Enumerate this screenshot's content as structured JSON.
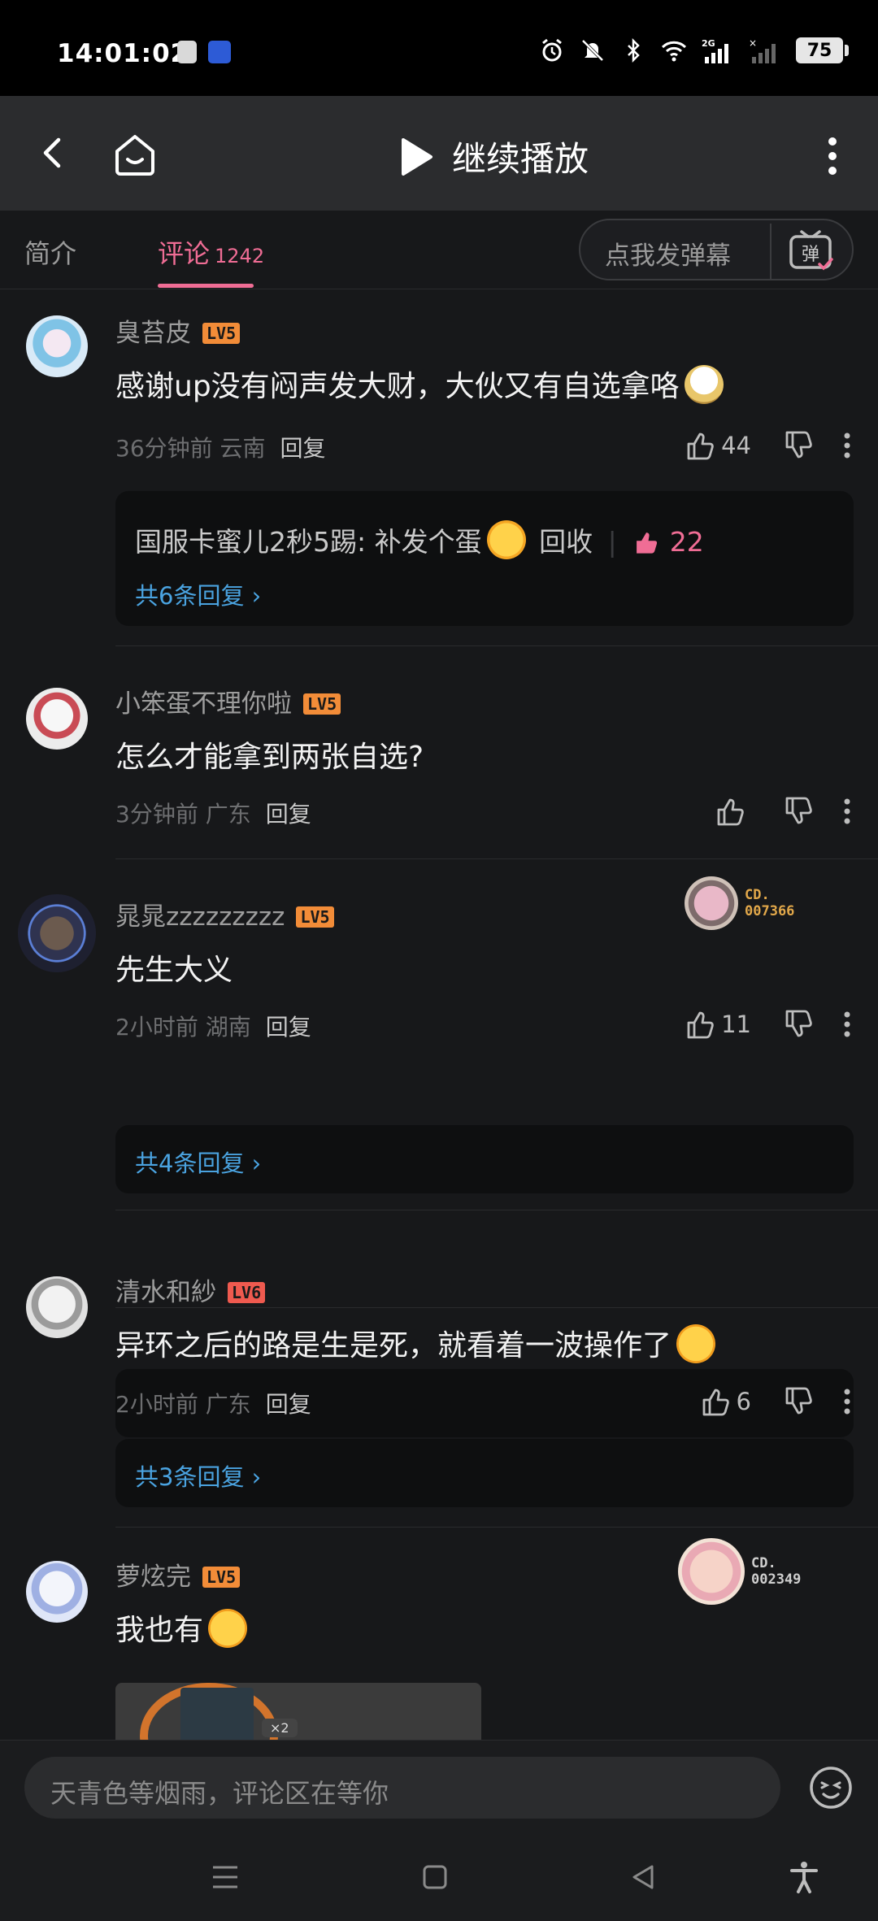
{
  "status_bar": {
    "time": "14:01:02",
    "battery": "75",
    "network": "2G"
  },
  "header": {
    "title": "继续播放"
  },
  "tabs": [
    {
      "label": "简介"
    },
    {
      "label": "评论",
      "count": "1242"
    }
  ],
  "danmaku": {
    "placeholder": "点我发弹幕",
    "icon_label": "弹"
  },
  "comments": [
    {
      "user": "臭苔皮",
      "level": "LV5",
      "text": "感谢up没有闷声发大财，大伙又有自选拿咯",
      "time": "36分钟前 云南",
      "reply": "回复",
      "likes": "44",
      "sub_reply": {
        "user": "国服卡蜜儿2秒5踢",
        "text": "补发个蛋",
        "action": "回收",
        "likes": "22"
      },
      "more_replies": "共6条回复"
    },
    {
      "user": "小笨蛋不理你啦",
      "level": "LV5",
      "text": "怎么才能拿到两张自选?",
      "time": "3分钟前 广东",
      "reply": "回复",
      "likes": ""
    },
    {
      "user": "晁晁zzzzzzzzz",
      "level": "LV5",
      "text": "先生大义",
      "time": "2小时前 湖南",
      "reply": "回复",
      "likes": "11",
      "badge": {
        "line1": "CD.",
        "line2": "007366"
      },
      "more_replies": "共4条回复"
    },
    {
      "user": "清水和紗",
      "level": "LV6",
      "text": "异环之后的路是生是死，就看着一波操作了",
      "time": "2小时前 广东",
      "reply": "回复",
      "likes": "6",
      "more_replies": "共3条回复"
    },
    {
      "user": "萝炫完",
      "level": "LV5",
      "text": "我也有",
      "badge": {
        "line1": "CD.",
        "line2": "002349"
      },
      "image_label": "×2"
    }
  ],
  "input": {
    "placeholder": "天青色等烟雨，评论区在等你"
  },
  "colors": {
    "accent": "#f06d95",
    "link": "#4aa3e0",
    "background": "#17181a",
    "lv5": "#f28c38",
    "lv6": "#ef5a4f"
  }
}
